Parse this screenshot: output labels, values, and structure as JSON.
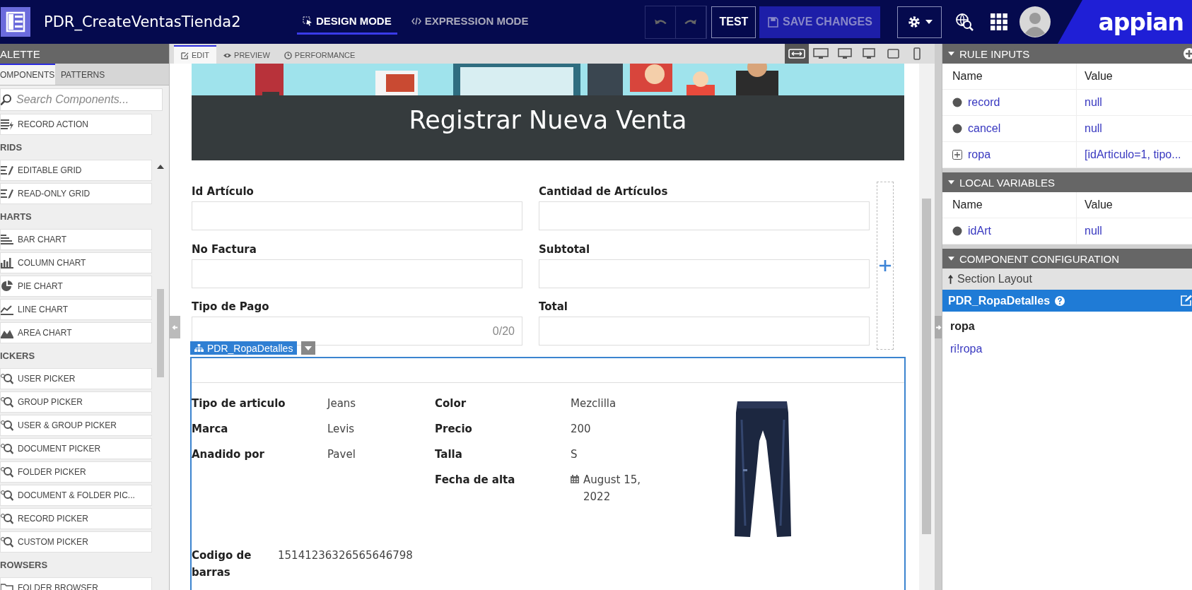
{
  "app_bar": {
    "title": "PDR_CreateVentasTienda2",
    "modes": [
      {
        "label": "DESIGN MODE",
        "selected": true
      },
      {
        "label": "EXPRESSION MODE",
        "selected": false
      }
    ],
    "test_button": "TEST",
    "save_button": {
      "label": "SAVE CHANGES",
      "disabled": true
    },
    "logo": "appian"
  },
  "palette": {
    "title": "ALETTE",
    "tabs": [
      {
        "label": "OMPONENTS",
        "selected": true
      },
      {
        "label": "PATTERNS",
        "selected": false
      }
    ],
    "search": {
      "placeholder": "Search Components..."
    },
    "entries": [
      {
        "kind": "item",
        "label": "RECORD ACTION"
      },
      {
        "kind": "header",
        "label": "RIDS"
      },
      {
        "kind": "item",
        "label": "EDITABLE GRID"
      },
      {
        "kind": "item",
        "label": "READ-ONLY GRID"
      },
      {
        "kind": "header",
        "label": "HARTS"
      },
      {
        "kind": "item",
        "label": "BAR CHART"
      },
      {
        "kind": "item",
        "label": "COLUMN CHART"
      },
      {
        "kind": "item",
        "label": "PIE CHART"
      },
      {
        "kind": "item",
        "label": "LINE CHART"
      },
      {
        "kind": "item",
        "label": "AREA CHART"
      },
      {
        "kind": "header",
        "label": "ICKERS"
      },
      {
        "kind": "item",
        "label": "USER PICKER"
      },
      {
        "kind": "item",
        "label": "GROUP PICKER"
      },
      {
        "kind": "item",
        "label": "USER & GROUP PICKER"
      },
      {
        "kind": "item",
        "label": "DOCUMENT PICKER"
      },
      {
        "kind": "item",
        "label": "FOLDER PICKER"
      },
      {
        "kind": "item",
        "label": "DOCUMENT & FOLDER PIC..."
      },
      {
        "kind": "item",
        "label": "RECORD PICKER"
      },
      {
        "kind": "item",
        "label": "CUSTOM PICKER"
      },
      {
        "kind": "header",
        "label": "ROWSERS"
      },
      {
        "kind": "item",
        "label": "FOLDER BROWSER"
      }
    ]
  },
  "canvas": {
    "tabs": [
      {
        "label": "EDIT",
        "selected": true
      },
      {
        "label": "PREVIEW",
        "selected": false
      },
      {
        "label": "PERFORMANCE",
        "selected": false
      }
    ],
    "devices": [
      {
        "selected": true
      },
      {
        "selected": false
      },
      {
        "selected": false
      },
      {
        "selected": false
      },
      {
        "selected": false
      },
      {
        "selected": false
      }
    ],
    "banner": {
      "title": "Registrar Nueva Venta"
    },
    "fields": [
      {
        "label": "Id Artículo"
      },
      {
        "label": "Cantidad de Artículos"
      },
      {
        "label": "No Factura"
      },
      {
        "label": "Subtotal"
      },
      {
        "label": "Tipo de Pago",
        "counter": "0/20"
      },
      {
        "label": "Total"
      }
    ],
    "section": {
      "tag": "PDR_RopaDetalles",
      "left": [
        {
          "label": "Tipo de articulo",
          "value": "Jeans"
        },
        {
          "label": "Marca",
          "value": "Levis"
        },
        {
          "label": "Anadido por",
          "value": "Pavel"
        }
      ],
      "right": [
        {
          "label": "Color",
          "value": "Mezclilla",
          "kind": "text"
        },
        {
          "label": "Precio",
          "value": "200",
          "kind": "text"
        },
        {
          "label": "Talla",
          "value": "S",
          "kind": "text"
        },
        {
          "label": "Fecha de alta",
          "value": "August 15, 2022",
          "kind": "date"
        }
      ],
      "barcode": {
        "label": "Codigo de barras",
        "value": "15141236326565646798"
      }
    }
  },
  "right_panel": {
    "rule_inputs": {
      "title": "RULE INPUTS",
      "columns": [
        "Name",
        "Value"
      ],
      "rows": [
        {
          "name": "record",
          "value": "null",
          "kind": "scalar"
        },
        {
          "name": "cancel",
          "value": "null",
          "kind": "scalar"
        },
        {
          "name": "ropa",
          "value": "[idArticulo=1, tipo...",
          "kind": "group",
          "expanded": false
        }
      ]
    },
    "local_variables": {
      "title": "LOCAL VARIABLES",
      "columns": [
        "Name",
        "Value"
      ],
      "rows": [
        {
          "name": "idArt",
          "value": "null",
          "kind": "scalar"
        }
      ]
    },
    "component_configuration": {
      "title": "COMPONENT CONFIGURATION",
      "parent": "Section Layout",
      "component": "PDR_RopaDetalles",
      "param_label": "ropa",
      "param_value": "ri!ropa"
    }
  }
}
